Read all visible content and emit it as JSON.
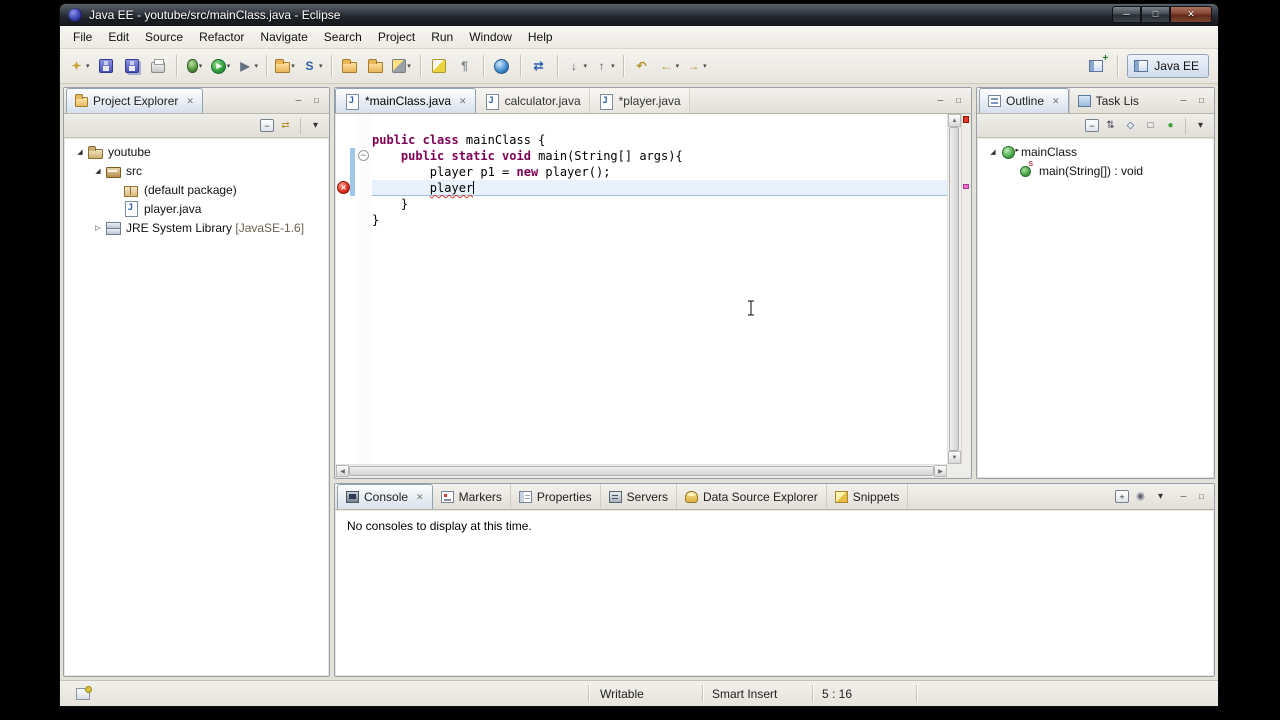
{
  "window": {
    "title": "Java EE - youtube/src/mainClass.java - Eclipse",
    "controls": [
      {
        "name": "minimize",
        "glyph": "─"
      },
      {
        "name": "maximize",
        "glyph": "□"
      },
      {
        "name": "close",
        "glyph": "✕"
      }
    ]
  },
  "icons": {
    "close": "✕",
    "dropdown": "▾",
    "minus": "−",
    "expander_open": "◢",
    "expander_closed": "▷",
    "scroll_up": "▲",
    "scroll_down": "▼",
    "scroll_left": "◀",
    "scroll_right": "▶"
  },
  "panel_controls": [
    {
      "name": "minimize",
      "glyph": "─"
    },
    {
      "name": "maximize",
      "glyph": "□"
    }
  ],
  "menubar": {
    "items": [
      "File",
      "Edit",
      "Source",
      "Refactor",
      "Navigate",
      "Search",
      "Project",
      "Run",
      "Window",
      "Help"
    ]
  },
  "toolbar": {
    "buttons": [
      {
        "name": "new-wizard",
        "glyph": "✦",
        "fg": "#caa53d",
        "dd": true
      },
      {
        "name": "save",
        "shape": "save"
      },
      {
        "name": "save-all",
        "shape": "saveall"
      },
      {
        "name": "print",
        "shape": "print"
      },
      {
        "sep": true
      },
      {
        "name": "debug",
        "shape": "debug",
        "dd": true
      },
      {
        "name": "run",
        "glyph": "▶",
        "shape": "run",
        "dd": true
      },
      {
        "name": "run-external-tools",
        "glyph": "▶",
        "fg": "#667080",
        "dd": true
      },
      {
        "sep": true
      },
      {
        "name": "new-dynamic-web-project",
        "shape": "folder",
        "dd": true
      },
      {
        "name": "new-servlet",
        "glyph": "S",
        "fg": "#2b5fb0",
        "dd": true
      },
      {
        "sep": true
      },
      {
        "name": "open-type",
        "shape": "folder"
      },
      {
        "name": "open-resource",
        "shape": "folder"
      },
      {
        "name": "search",
        "shape": "flash",
        "dd": true
      },
      {
        "sep": true
      },
      {
        "name": "mark-occurrences",
        "shape": "hl"
      },
      {
        "name": "show-whitespace",
        "glyph": "¶",
        "fg": "#7a828c"
      },
      {
        "sep": true
      },
      {
        "name": "open-web-browser",
        "shape": "globe"
      },
      {
        "sep": true
      },
      {
        "name": "synchronize",
        "glyph": "⇄",
        "fg": "#2b5fb0"
      },
      {
        "sep": true
      },
      {
        "name": "next-annotation",
        "glyph": "↓",
        "fg": "#556",
        "dd": true
      },
      {
        "name": "previous-annotation",
        "glyph": "↑",
        "fg": "#556",
        "dd": true
      },
      {
        "sep": true
      },
      {
        "name": "last-edit-location",
        "glyph": "↶",
        "fg": "#b8912f"
      },
      {
        "name": "back",
        "glyph": "←",
        "fg": "#b8912f",
        "dd": true
      },
      {
        "name": "forward",
        "glyph": "→",
        "fg": "#b8912f",
        "dd": true
      }
    ]
  },
  "perspective": {
    "active": "Java EE"
  },
  "project_explorer": {
    "title": "Project Explorer",
    "toolbar": [
      {
        "name": "collapse-all",
        "glyph": "−",
        "boxed": true
      },
      {
        "name": "link-with-editor",
        "glyph": "⇄",
        "fg": "#b8912f"
      },
      {
        "sep": true
      },
      {
        "name": "view-menu",
        "glyph": "▾",
        "fg": "#333"
      }
    ],
    "tree": [
      {
        "label": "youtube",
        "level": 0,
        "icon": "project",
        "exp": "open"
      },
      {
        "label": "src",
        "level": 1,
        "icon": "src",
        "exp": "open"
      },
      {
        "label": "(default package)",
        "level": 2,
        "icon": "package"
      },
      {
        "label": "player.java",
        "level": 2,
        "icon": "jfile"
      },
      {
        "label": "JRE System Library",
        "suffix": "[JavaSE-1.6]",
        "level": 1,
        "icon": "library",
        "exp": "closed"
      }
    ]
  },
  "editor": {
    "tabs": [
      {
        "label": "*mainClass.java",
        "active": true
      },
      {
        "label": "calculator.java"
      },
      {
        "label": "*player.java"
      }
    ],
    "code": [
      {
        "tokens": [
          {
            "c": "kw",
            "s": "public class "
          },
          {
            "c": "pl",
            "s": "mainClass {"
          }
        ]
      },
      {
        "tokens": [
          {
            "c": "kw",
            "s": "    public static void "
          },
          {
            "c": "pl",
            "s": "main(String[] args){"
          }
        ]
      },
      {
        "tokens": [
          {
            "c": "pl",
            "s": "        player p1 = "
          },
          {
            "c": "kw",
            "s": "new"
          },
          {
            "c": "pl",
            "s": " player();"
          }
        ]
      },
      {
        "current": true,
        "caret": true,
        "tokens": [
          {
            "c": "pl",
            "s": "        "
          },
          {
            "c": "err",
            "s": "player"
          }
        ]
      },
      {
        "tokens": [
          {
            "c": "pl",
            "s": "    }"
          }
        ]
      },
      {
        "tokens": [
          {
            "c": "pl",
            "s": "}"
          }
        ]
      }
    ],
    "markers": {
      "fold_line": 2,
      "error_line": 4,
      "diff_start": 2,
      "diff_end": 4
    }
  },
  "outline": {
    "title": "Outline",
    "other_tab": "Task Lis",
    "toolbar": [
      {
        "name": "collapse-all",
        "glyph": "−",
        "boxed": true
      },
      {
        "name": "sort",
        "glyph": "⇅",
        "fg": "#445"
      },
      {
        "name": "hide-fields",
        "glyph": "◇",
        "fg": "#2b5fb0"
      },
      {
        "name": "hide-static-members",
        "glyph": "□",
        "fg": "#556"
      },
      {
        "name": "hide-non-public-members",
        "glyph": "●",
        "fg": "#3d9e3d"
      },
      {
        "sep": true
      },
      {
        "name": "view-menu",
        "glyph": "▾",
        "fg": "#333"
      }
    ],
    "nodes": [
      {
        "label": "mainClass",
        "level": 0,
        "icon": "class",
        "exp": "open"
      },
      {
        "label": "main(String[]) : void",
        "level": 1,
        "icon": "method-static"
      }
    ]
  },
  "console": {
    "tabs": [
      {
        "label": "Console",
        "icon": "console",
        "active": true
      },
      {
        "label": "Markers",
        "icon": "markers"
      },
      {
        "label": "Properties",
        "icon": "properties"
      },
      {
        "label": "Servers",
        "icon": "servers"
      },
      {
        "label": "Data Source Explorer",
        "icon": "dse"
      },
      {
        "label": "Snippets",
        "icon": "snippets"
      }
    ],
    "toolbar": [
      {
        "name": "open-console",
        "glyph": "+",
        "boxed": true
      },
      {
        "name": "pin-console",
        "glyph": "◉",
        "fg": "#667"
      },
      {
        "name": "view-menu",
        "glyph": "▾",
        "fg": "#333"
      }
    ],
    "message": "No consoles to display at this time."
  },
  "statusbar": {
    "writable": "Writable",
    "insert_mode": "Smart Insert",
    "cursor_position": "5 : 16"
  }
}
